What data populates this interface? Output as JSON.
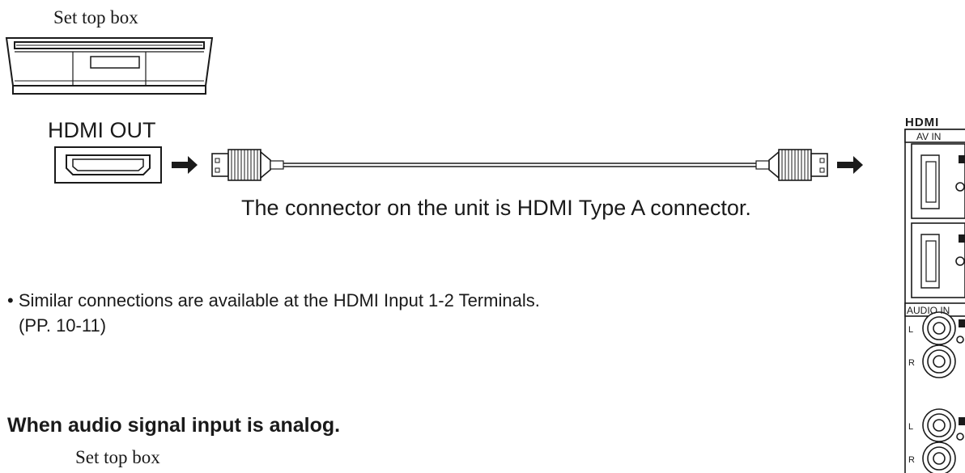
{
  "labels": {
    "set_top_box_top": "Set top box",
    "hdmi_out": "HDMI OUT",
    "connector_note": "The connector on the unit is HDMI Type A connector.",
    "similar_note_line1": "• Similar connections are available at the HDMI Input 1-2 Terminals.",
    "similar_note_line2": "(PP. 10-11)",
    "analog_heading": "When audio signal input is analog.",
    "set_top_box_bottom": "Set top box"
  },
  "panel": {
    "logo": "HDMI",
    "av_in": "AV IN",
    "audio_in": "AUDIO IN",
    "left": "L",
    "right": "R"
  },
  "colors": {
    "line": "#1a1a1a",
    "panel_fill": "#ffffff"
  }
}
